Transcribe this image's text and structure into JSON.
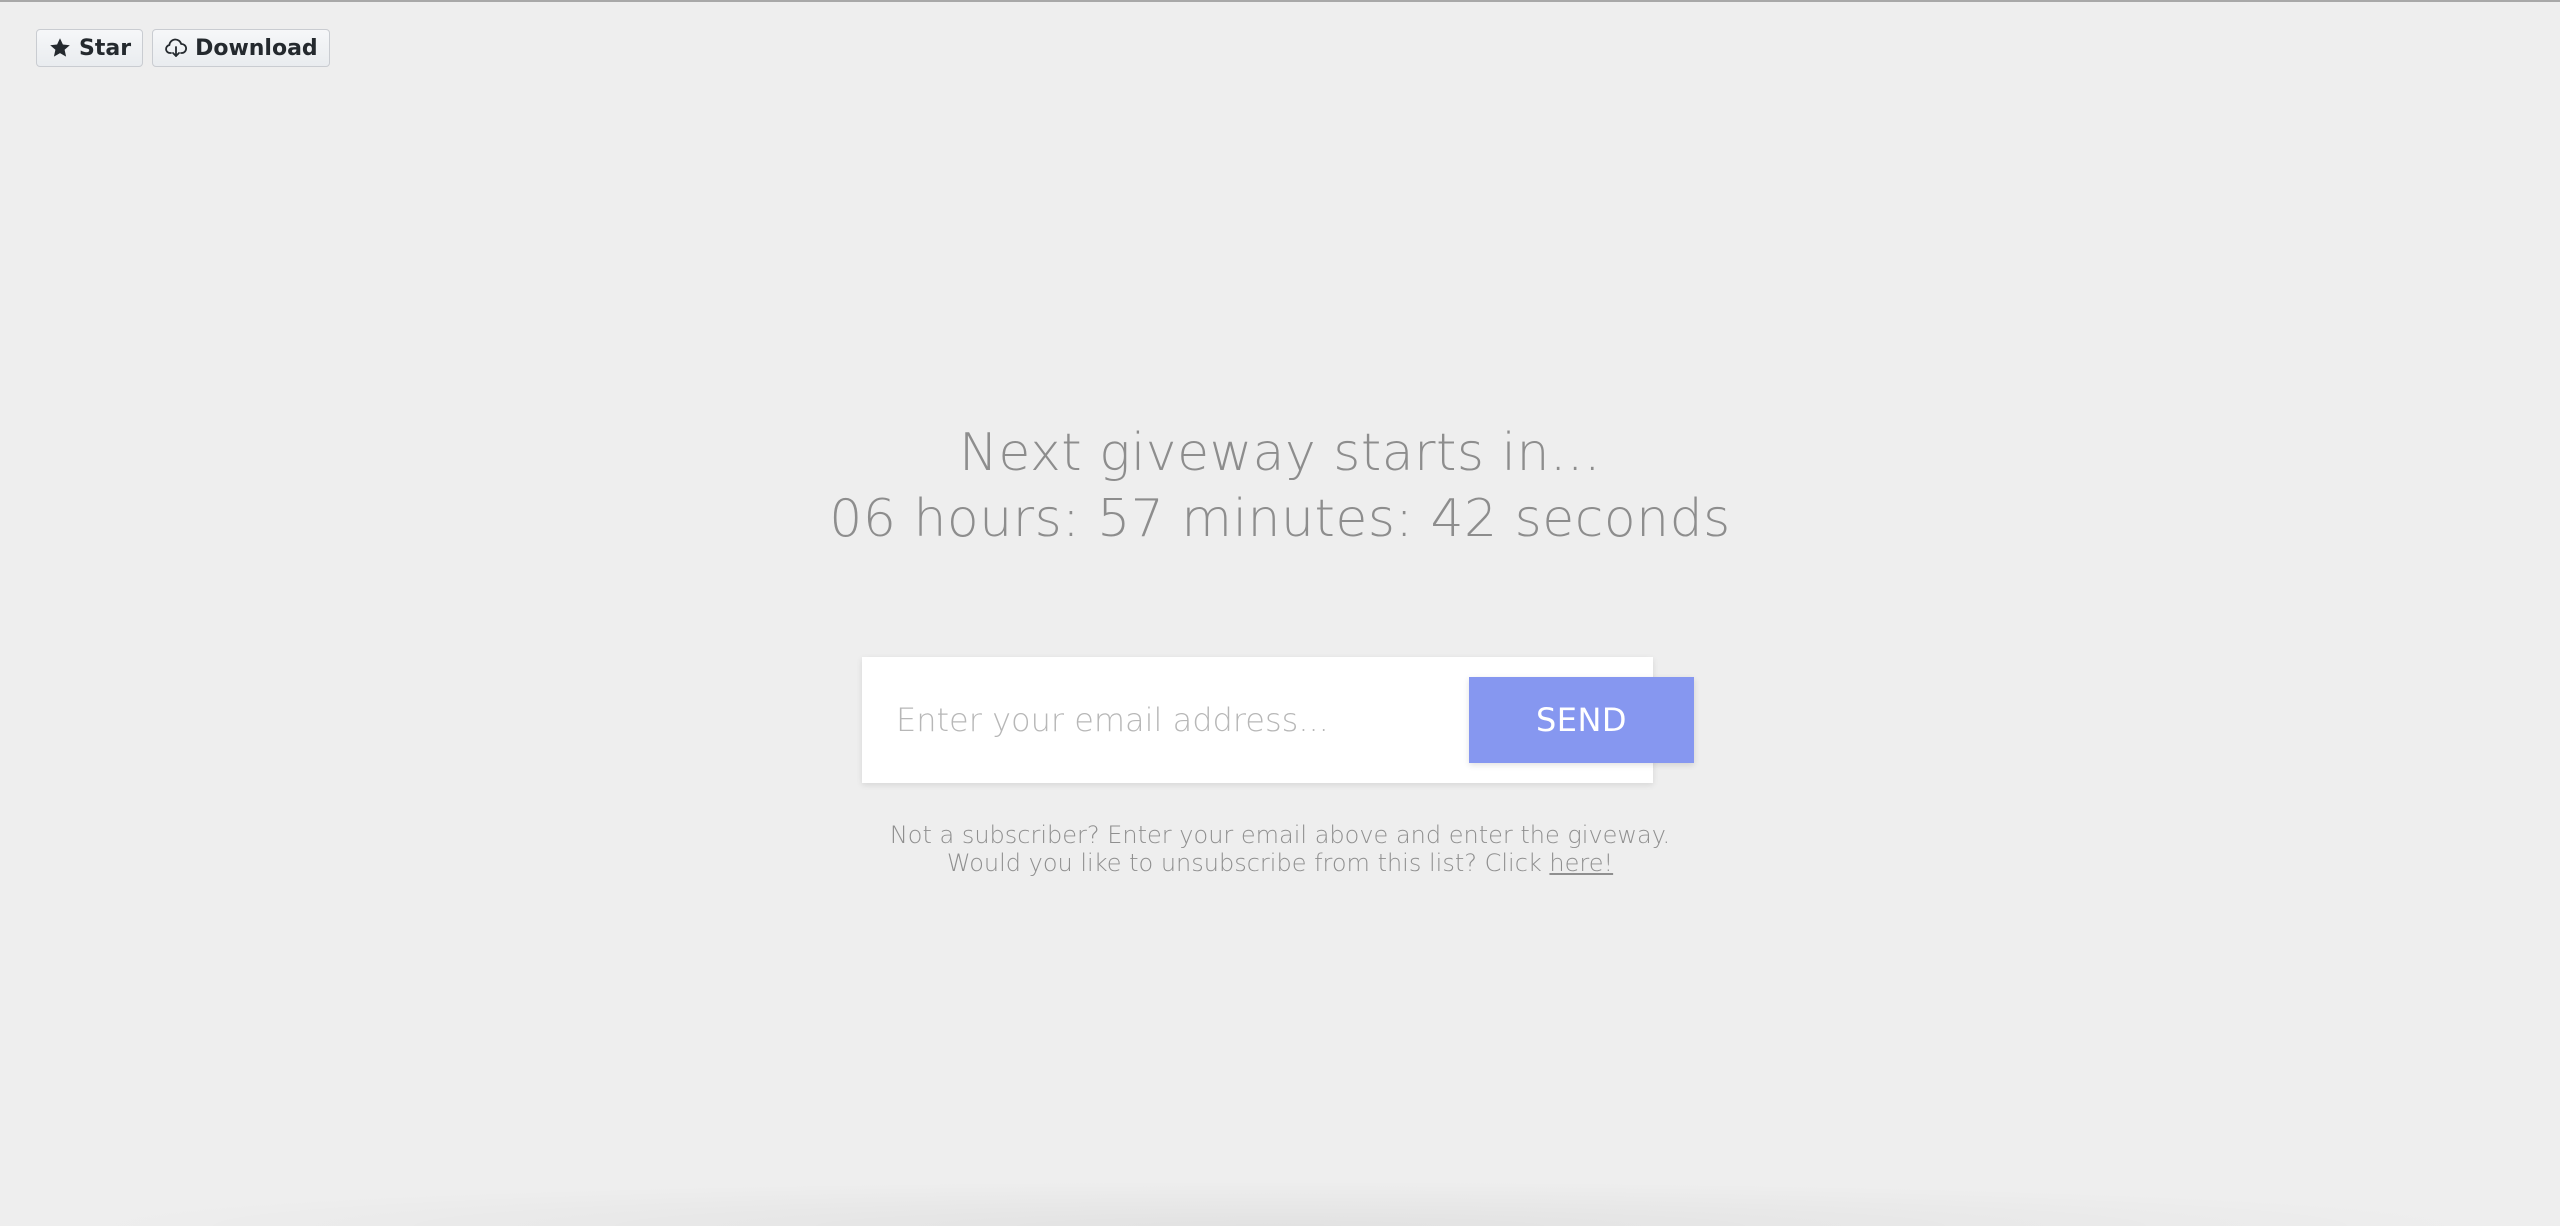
{
  "toolbar": {
    "star_label": "Star",
    "star_icon": "star-icon",
    "download_label": "Download",
    "download_icon": "cloud-download-icon"
  },
  "countdown": {
    "line1": "Next giveway starts in...",
    "line2": "06 hours: 57 minutes: 42 seconds"
  },
  "subscribe": {
    "email_placeholder": "Enter your email address...",
    "email_value": "",
    "send_label": "SEND"
  },
  "info": {
    "line1": "Not a subscriber? Enter your email above and enter the giveway.",
    "line2_prefix": "Would you like to unsubscribe from this list? Click ",
    "link_label": "here!"
  },
  "colors": {
    "background": "#eeeeee",
    "accent": "#8697f0",
    "text_muted": "#8d8d8d"
  }
}
